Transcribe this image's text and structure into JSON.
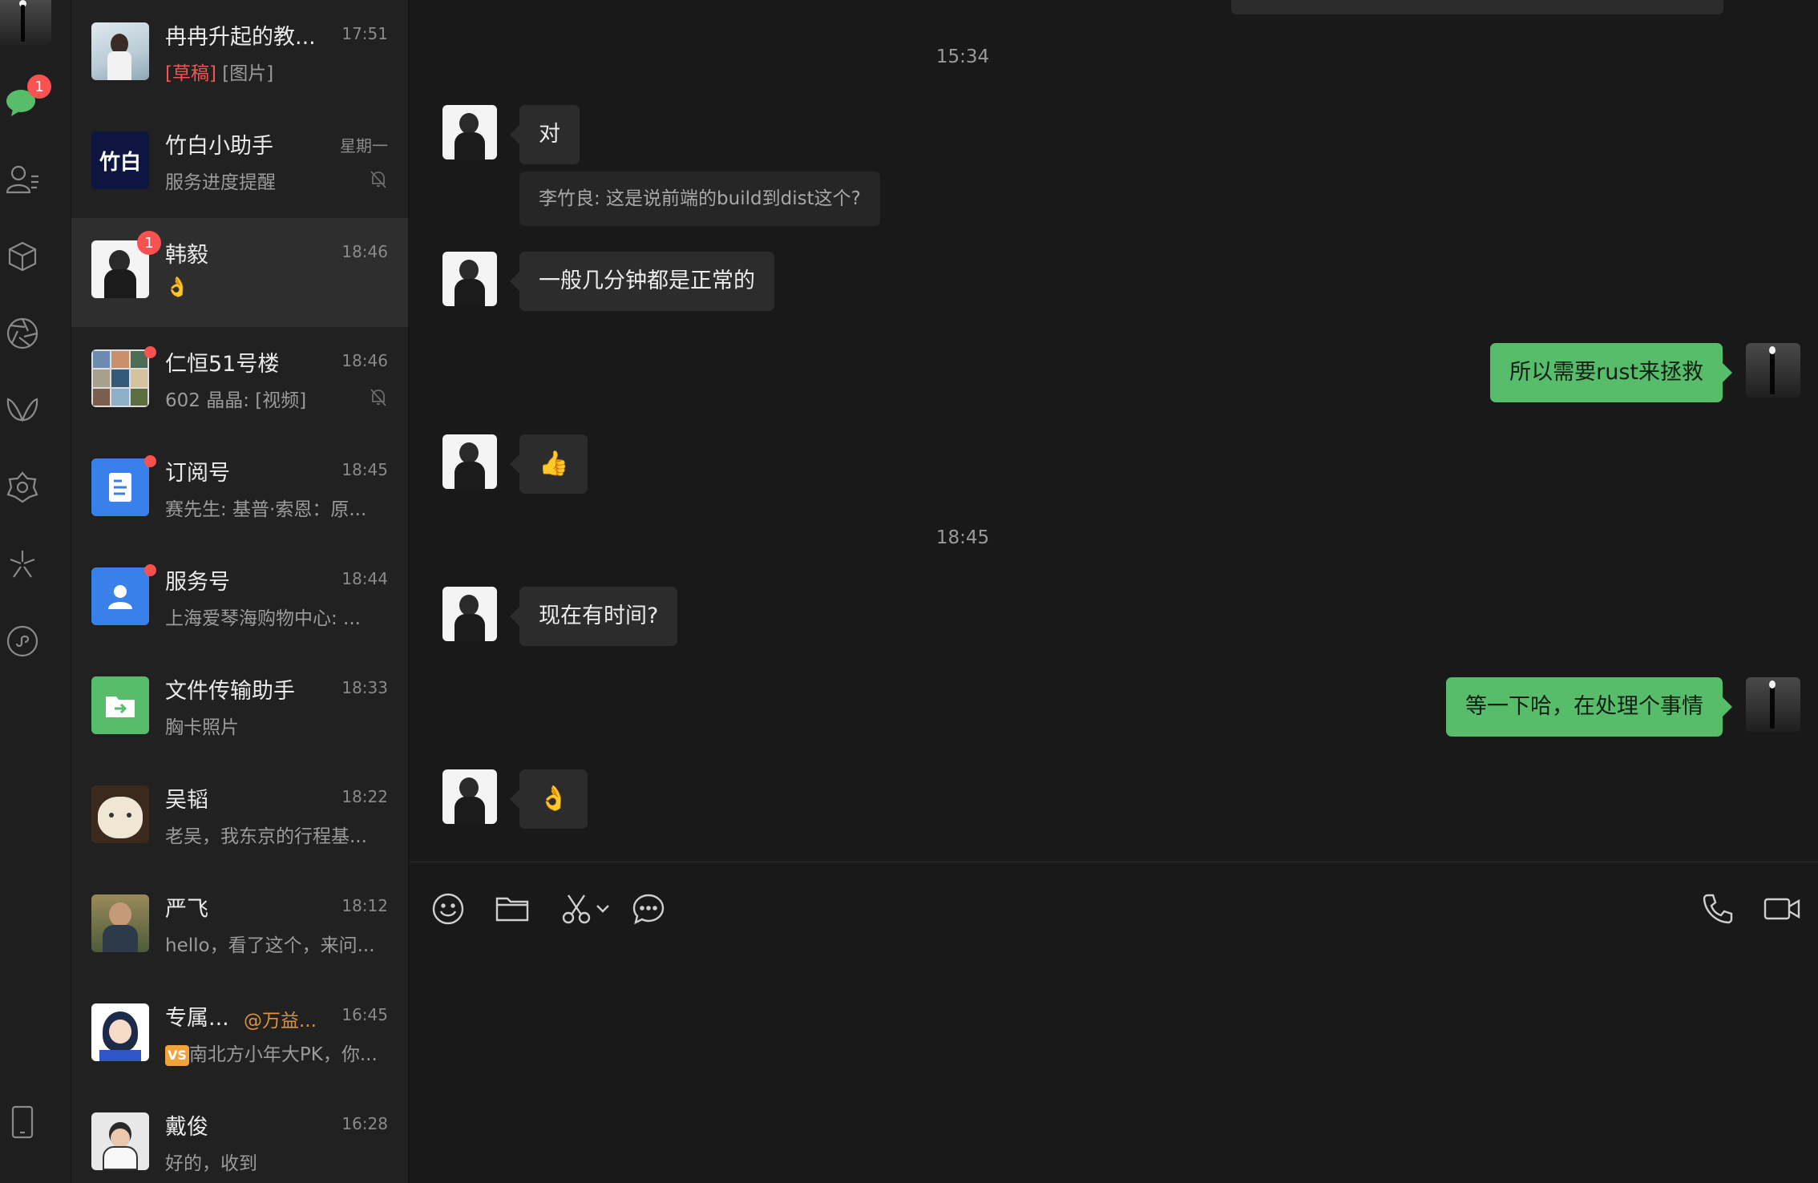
{
  "rail": {
    "chat_badge": "1",
    "icons": [
      "chat-icon",
      "contacts-icon",
      "cube-icon",
      "moments-icon",
      "channels-icon",
      "search-discover-icon",
      "spark-icon",
      "mini-program-icon",
      "phone-device-icon"
    ]
  },
  "conversations": [
    {
      "name": "冉冉升起的教...",
      "time": "17:51",
      "draft": "[草稿]",
      "preview": "[图片]",
      "muted": false,
      "unread": ""
    },
    {
      "name": "竹白小助手",
      "time": "星期一",
      "preview": "服务进度提醒",
      "muted": true,
      "avatar_text": "竹白"
    },
    {
      "name": "韩毅",
      "time": "18:46",
      "preview": "👌",
      "unread": "1",
      "active": true
    },
    {
      "name": "仁恒51号楼",
      "time": "18:46",
      "preview": "602 晶晶: [视频]",
      "muted": true,
      "dot": true
    },
    {
      "name": "订阅号",
      "time": "18:45",
      "preview": "赛先生: 基普·索恩：原...",
      "dot": true
    },
    {
      "name": "服务号",
      "time": "18:44",
      "preview": "上海爱琴海购物中心: ...",
      "dot": true
    },
    {
      "name": "文件传输助手",
      "time": "18:33",
      "preview": "胸卡照片"
    },
    {
      "name": "吴韬",
      "time": "18:22",
      "preview": "老吴，我东京的行程基..."
    },
    {
      "name": "严飞",
      "time": "18:12",
      "preview": "hello，看了这个，来问..."
    },
    {
      "name": "专属...",
      "mention": "@万益...",
      "time": "16:45",
      "preview": "南北方小年大PK，你...",
      "vs": "VS"
    },
    {
      "name": "戴俊",
      "time": "16:28",
      "preview": "好的，收到"
    }
  ],
  "chat": {
    "stamp1": "15:34",
    "msg1": "对",
    "quote1": "李竹良: 这是说前端的build到dist这个?",
    "msg2": "一般几分钟都是正常的",
    "msg3_out": "所以需要rust来拯救",
    "msg4": "👍",
    "stamp2": "18:45",
    "msg5": "现在有时间?",
    "msg6_out": "等一下哈，在处理个事情",
    "msg7": "👌"
  },
  "composer": {
    "placeholder": ""
  },
  "colors": {
    "accent": "#57bd6a",
    "badge": "#fa5151",
    "background": "#191919"
  }
}
